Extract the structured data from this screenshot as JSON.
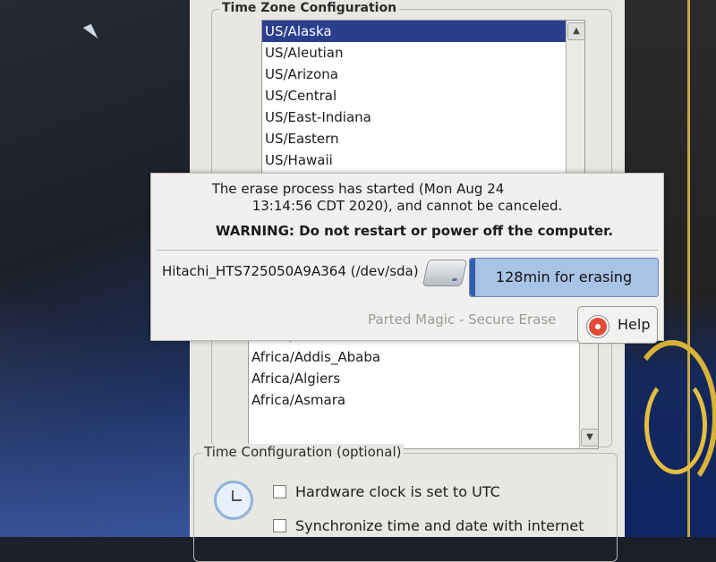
{
  "timezone": {
    "group_title": "Time Zone Configuration",
    "list_top": [
      "US/Alaska",
      "US/Aleutian",
      "US/Arizona",
      "US/Central",
      "US/East-Indiana",
      "US/Eastern",
      "US/Hawaii"
    ],
    "selected_index": 0,
    "list_bottom": [
      "Africa/Accra",
      "Africa/Addis_Ababa",
      "Africa/Algiers",
      "Africa/Asmara"
    ]
  },
  "time_config": {
    "group_title": "Time Configuration (optional)",
    "hardware_clock_label": "Hardware clock is set to UTC",
    "sync_label": "Synchronize time and date with internet",
    "hardware_clock_checked": false,
    "sync_checked": false
  },
  "erase_dialog": {
    "message_line1": "The erase process has started (Mon Aug 24",
    "message_line2": "13:14:56 CDT 2020), and cannot be canceled.",
    "warning": "WARNING: Do not restart or power off the computer.",
    "device": "Hitachi_HTS725050A9A364 (/dev/sda)",
    "progress_text": "128min for erasing",
    "progress_fraction": 0.03,
    "brand": "Parted Magic - Secure Erase",
    "help_label": "Help",
    "icons": {
      "disk": "hard-drive-icon",
      "help": "lifebuoy-help-icon",
      "clock": "clock-icon"
    }
  },
  "colors": {
    "selection": "#2b3e8e",
    "progress_fill": "#2f5fae",
    "progress_bg": "#a9c3e6",
    "brand_text": "#9c9a96"
  }
}
